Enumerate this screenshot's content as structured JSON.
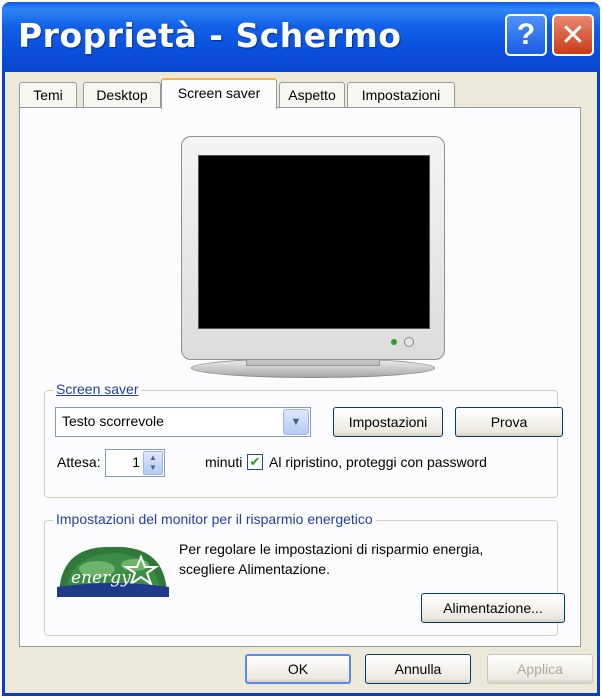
{
  "window": {
    "title": "Proprietà - Schermo",
    "help_glyph": "?",
    "close_glyph": "✕"
  },
  "tabs": [
    {
      "label": "Temi"
    },
    {
      "label": "Desktop"
    },
    {
      "label": "Screen saver",
      "active": true
    },
    {
      "label": "Aspetto"
    },
    {
      "label": "Impostazioni"
    }
  ],
  "screensaver": {
    "group_label": "Screen saver",
    "selected": "Testo scorrevole",
    "settings_button": "Impostazioni",
    "preview_button": "Prova",
    "wait_label": "Attesa:",
    "wait_value": "1",
    "wait_unit": "minuti",
    "password_label": "Al ripristino, proteggi con password",
    "password_checked": true
  },
  "energy": {
    "group_label": "Impostazioni del monitor per il risparmio energetico",
    "logo_text": "energy",
    "description_line1": "Per regolare le impostazioni di risparmio energia,",
    "description_line2": "scegliere Alimentazione.",
    "power_button": "Alimentazione..."
  },
  "footer": {
    "ok": "OK",
    "cancel": "Annulla",
    "apply": "Applica"
  },
  "colors": {
    "titlebar": "#0a4fdc",
    "group_label": "#1f3fa8",
    "tab_highlight": "#f7b44a"
  }
}
